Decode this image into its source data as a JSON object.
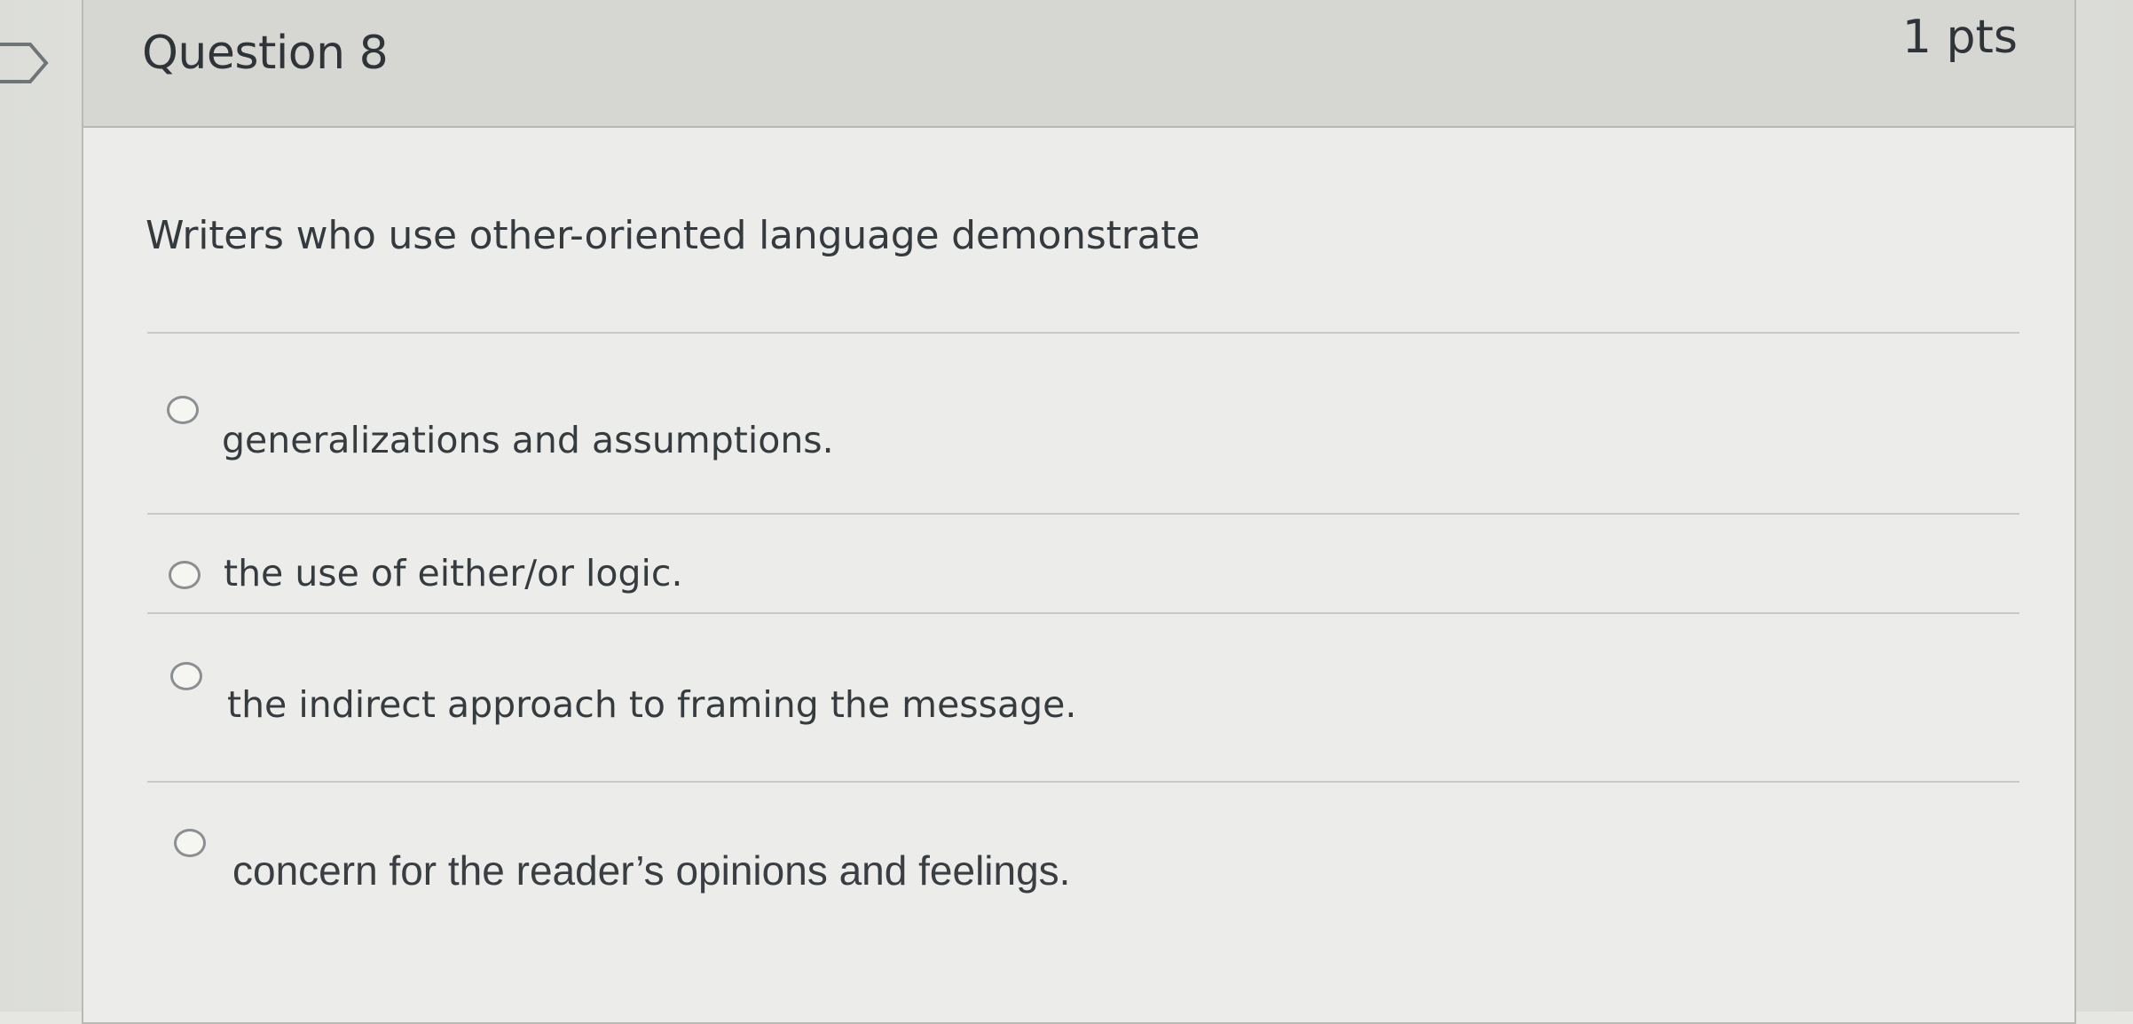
{
  "question": {
    "title": "Question 8",
    "points": "1 pts",
    "prompt": "Writers who use other-oriented language demonstrate",
    "answers": [
      {
        "label": "generalizations and assumptions.",
        "selected": false
      },
      {
        "label": "the use of either/or logic.",
        "selected": false
      },
      {
        "label": "the indirect approach to framing the message.",
        "selected": false
      },
      {
        "label": "concern for the reader’s opinions and feelings.",
        "selected": false
      }
    ]
  },
  "icons": {
    "flag": "flag-icon",
    "radio": "radio-unselected-icon"
  },
  "colors": {
    "header_bg": "#d6d7d3",
    "card_bg": "#ecedea",
    "text": "#353a3e",
    "radio_border": "#8b8f92"
  }
}
